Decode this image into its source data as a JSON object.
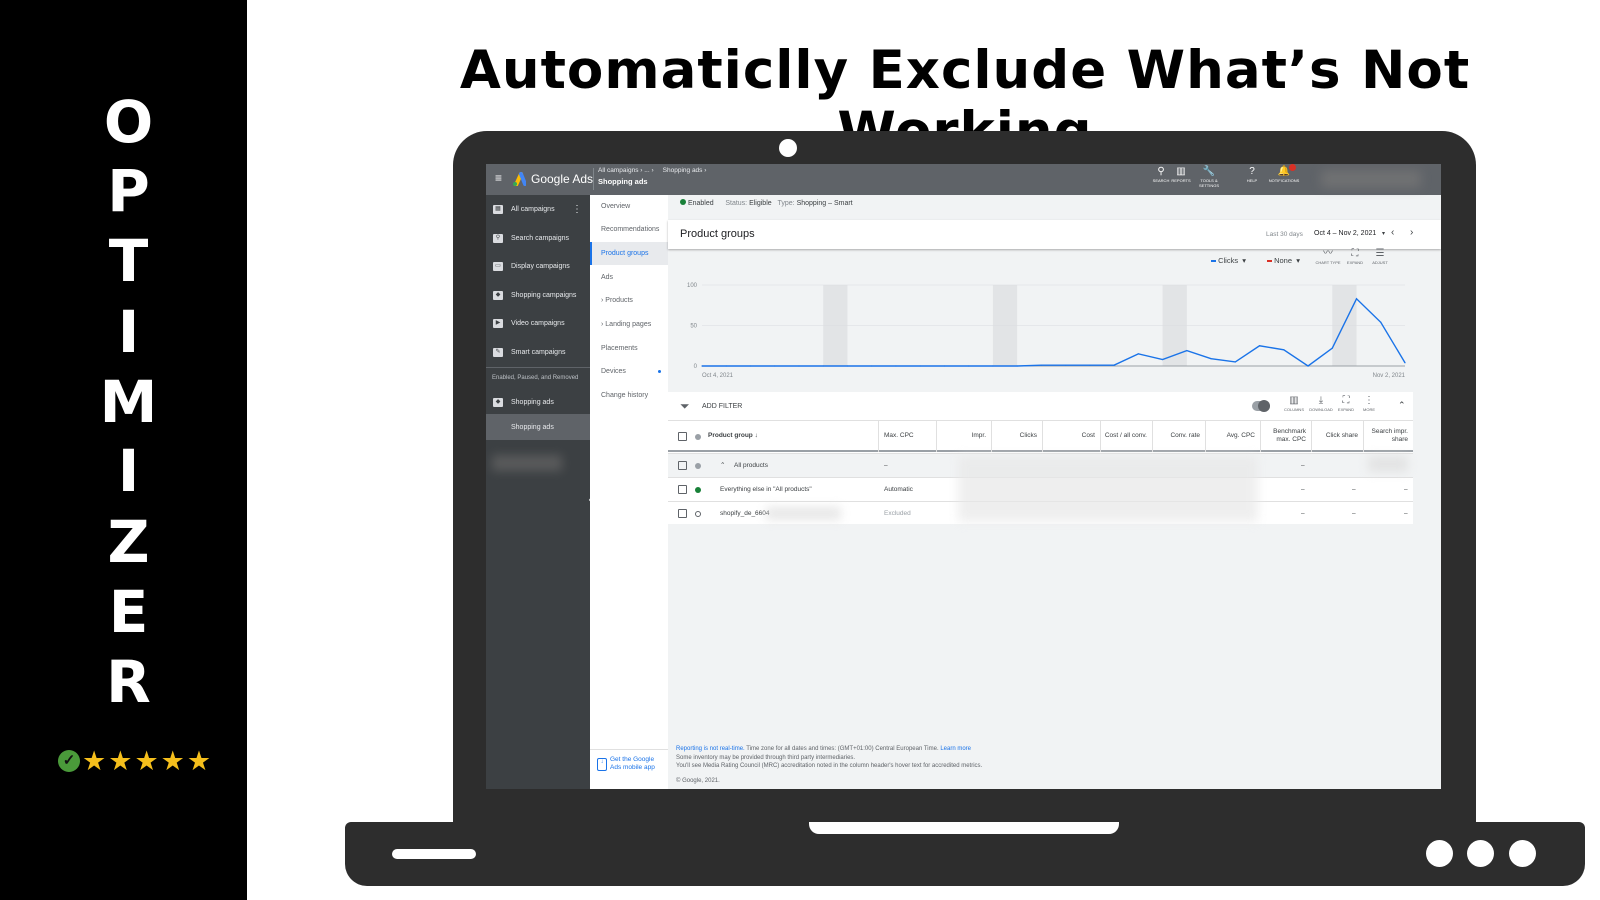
{
  "brand": {
    "vertical_letters": [
      "O",
      "P",
      "T",
      "I",
      "M",
      "I",
      "Z",
      "E",
      "R"
    ],
    "rating_stars": 5,
    "rating_check": "check-circle-icon",
    "headline": "Automaticlly Exclude What’s Not Working"
  },
  "app": {
    "name": "Google Ads",
    "breadcrumb": [
      "All campaigns",
      "...",
      "Shopping ads"
    ],
    "current": "Shopping ads",
    "toolbar": [
      {
        "icon": "search-icon",
        "label": "SEARCH"
      },
      {
        "icon": "reports-icon",
        "label": "REPORTS"
      },
      {
        "icon": "wrench-icon",
        "label": "TOOLS & SETTINGS"
      },
      {
        "icon": "help-icon",
        "label": "HELP"
      },
      {
        "icon": "bell-icon",
        "label": "NOTIFICATIONS"
      }
    ],
    "notification_badge_color": "#d93025"
  },
  "sidebar": {
    "items": [
      {
        "label": "All campaigns",
        "icon": "grid-icon"
      },
      {
        "label": "Search campaigns",
        "icon": "search-campaign-icon"
      },
      {
        "label": "Display campaigns",
        "icon": "display-icon"
      },
      {
        "label": "Shopping campaigns",
        "icon": "tag-icon"
      },
      {
        "label": "Video campaigns",
        "icon": "video-icon"
      },
      {
        "label": "Smart campaigns",
        "icon": "smart-icon"
      }
    ],
    "filter_label": "Enabled, Paused, and Removed",
    "campaign": "Shopping ads",
    "ad_group": "Shopping ads"
  },
  "subnav": {
    "items": [
      "Overview",
      "Recommendations",
      "Product groups",
      "Ads",
      "Products",
      "Landing pages",
      "Placements",
      "Devices",
      "Change history"
    ],
    "selected": "Product groups",
    "app_promo": "Get the Google Ads mobile app"
  },
  "status": {
    "enabled": "Enabled",
    "status_label": "Status:",
    "status_value": "Eligible",
    "type_label": "Type:",
    "type_value": "Shopping – Smart"
  },
  "page": {
    "title": "Product groups",
    "range_label": "Last 30 days",
    "range_value": "Oct 4 – Nov 2, 2021"
  },
  "chart_controls": {
    "metric1": "Clicks",
    "metric2": "None",
    "metric1_color": "#1a73e8",
    "metric2_color": "#d93025",
    "buttons": [
      "CHART TYPE",
      "EXPAND",
      "ADJUST"
    ]
  },
  "chart_data": {
    "type": "line",
    "x_start_label": "Oct 4, 2021",
    "x_end_label": "Nov 2, 2021",
    "ylim": [
      0,
      100
    ],
    "yticks": [
      "0",
      "50",
      "100"
    ],
    "grid": true,
    "weekend_band_days": [
      5,
      12,
      19,
      26
    ],
    "series": [
      {
        "color": "#1a73e8",
        "values": [
          0,
          0,
          0,
          0,
          0,
          0,
          0,
          0,
          0,
          0,
          0,
          0,
          0,
          0,
          1,
          1,
          1,
          1,
          15,
          8,
          19,
          9,
          5,
          25,
          20,
          0,
          22,
          83,
          54,
          4
        ]
      }
    ]
  },
  "table_toolbar": {
    "add_filter": "ADD FILTER",
    "buttons": [
      "COLUMNS",
      "DOWNLOAD",
      "EXPAND",
      "MORE"
    ]
  },
  "table": {
    "columns": [
      "Product group",
      "Max. CPC",
      "Impr.",
      "Clicks",
      "Cost",
      "Cost / all conv.",
      "Conv. rate",
      "Avg. CPC",
      "Benchmark max. CPC",
      "Click share",
      "Search impr. share"
    ],
    "rows": [
      {
        "name": "All products",
        "max_cpc": "–",
        "benchmark": "–",
        "click_share": "",
        "search_share": "",
        "status": "gray"
      },
      {
        "name": "Everything else in \"All products\"",
        "max_cpc": "Automatic",
        "benchmark": "–",
        "click_share": "–",
        "search_share": "–",
        "status": "green"
      },
      {
        "name": "shopify_de_6604",
        "max_cpc": "Excluded",
        "benchmark": "–",
        "click_share": "–",
        "search_share": "–",
        "status": "excluded"
      }
    ]
  },
  "footer": {
    "realtime_link": "Reporting is not real-time.",
    "timezone": "Time zone for all dates and times: (GMT+01:00) Central European Time.",
    "learn_more": "Learn more",
    "line2": "Some inventory may be provided through third party intermediaries.",
    "line3": "You'll see Media Rating Council (MRC) accreditation noted in the column header's hover text for accredited metrics.",
    "copyright": "© Google, 2021."
  }
}
